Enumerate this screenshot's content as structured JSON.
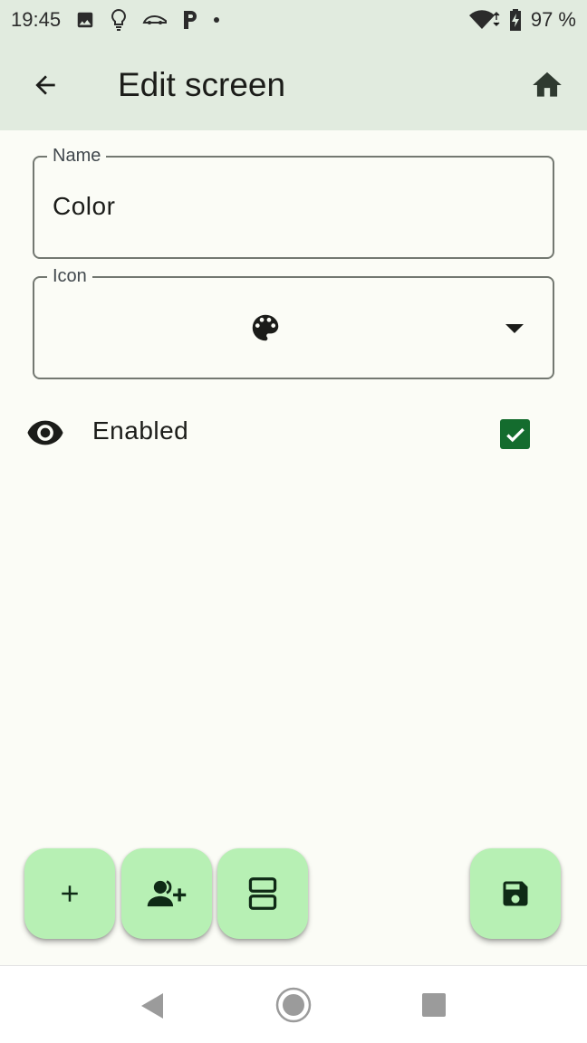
{
  "status_bar": {
    "time": "19:45",
    "battery": "97 %",
    "left_icons": [
      "image-icon",
      "lightbulb-icon",
      "car-icon",
      "parking-icon",
      "dot-icon"
    ],
    "right_icons": [
      "wifi-icon",
      "battery-charging-icon"
    ]
  },
  "top_bar": {
    "title": "Edit screen",
    "back_icon": "arrow-back-icon",
    "home_icon": "home-icon",
    "color": "#e1ebdf"
  },
  "form": {
    "name_label": "Name",
    "name_value": "Color",
    "icon_label": "Icon",
    "icon_selected": "palette-icon"
  },
  "enabled": {
    "label": "Enabled",
    "icon": "eye-icon",
    "checked": true
  },
  "fabs": [
    {
      "icon": "add-icon"
    },
    {
      "icon": "person-add-icon"
    },
    {
      "icon": "layout-rows-icon"
    },
    {
      "icon": "save-icon"
    }
  ],
  "colors": {
    "background": "#fbfcf6",
    "fab": "#b7f0b4",
    "checkbox": "#146c2e",
    "icon_dark": "#0f2a16"
  },
  "nav_bar": {
    "icons": [
      "nav-back-icon",
      "nav-home-icon",
      "nav-recents-icon"
    ]
  }
}
